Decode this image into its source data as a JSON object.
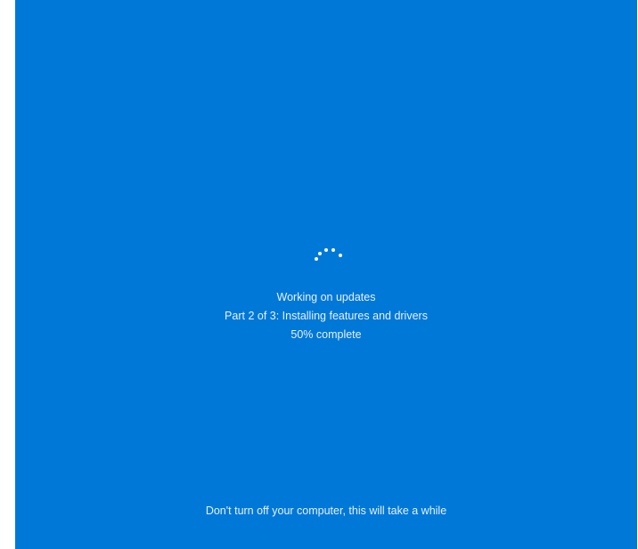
{
  "screen": {
    "background_color": "#0078d7",
    "text_color": "#e6f1fb",
    "spinner_icon": "loading-dots-icon"
  },
  "status": {
    "heading": "Working on updates",
    "part": "Part 2 of 3: Installing features and drivers",
    "progress_text": "50% complete",
    "progress_fraction": 0.5
  },
  "footer": {
    "message": "Don't turn off your computer, this will take a while"
  }
}
